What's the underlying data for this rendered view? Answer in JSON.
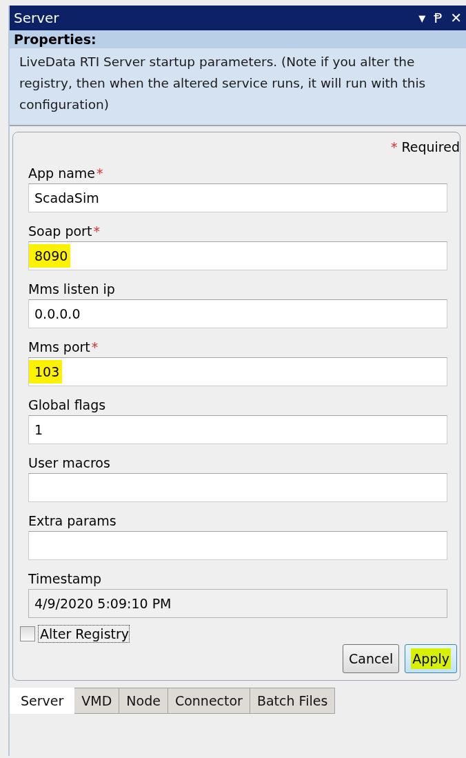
{
  "window": {
    "title": "Server",
    "controls": [
      "▾",
      "Ᵽ",
      "✕"
    ]
  },
  "properties": {
    "heading": "Properties:",
    "description": "LiveData RTI Server startup parameters. (Note if you alter the registry, then when the altered service runs, it will run with this configuration)"
  },
  "required_note": {
    "mark": "*",
    "text": "Required"
  },
  "fields": [
    {
      "label": "App name",
      "mark": "*",
      "value": "ScadaSim",
      "highlighted": false,
      "readonly": false
    },
    {
      "label": "Soap port",
      "mark": "*",
      "value": "8090",
      "highlighted": true,
      "readonly": false
    },
    {
      "label": "Mms listen ip",
      "value": "0.0.0.0",
      "highlighted": false,
      "readonly": false
    },
    {
      "label": "Mms port",
      "mark": "*",
      "value": "103",
      "highlighted": true,
      "readonly": false
    },
    {
      "label": "Global flags",
      "value": "1",
      "highlighted": false,
      "readonly": false
    },
    {
      "label": "User macros",
      "readonly": false
    },
    {
      "label": "Extra params",
      "readonly": false
    },
    {
      "label": "Timestamp",
      "value": "4/9/2020 5:09:10 PM",
      "highlighted": false,
      "readonly": true
    }
  ],
  "alter_registry": {
    "label": "Alter Registry",
    "checked": false
  },
  "buttons": [
    {
      "label": "Cancel",
      "highlighted": false
    },
    {
      "label": "Apply",
      "highlighted": true
    }
  ],
  "tabs": [
    {
      "label": "Server",
      "selected": true
    },
    {
      "label": "VMD",
      "selected": false
    },
    {
      "label": "Node",
      "selected": false
    },
    {
      "label": "Connector",
      "selected": false
    },
    {
      "label": "Batch Files",
      "selected": false
    }
  ]
}
